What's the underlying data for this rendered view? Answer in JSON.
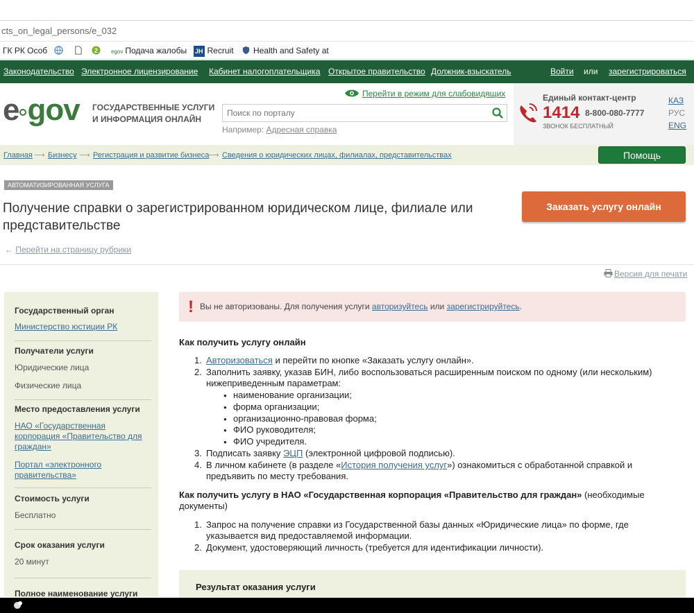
{
  "browser": {
    "url": "cts_on_legal_persons/e_032",
    "bookmarks": [
      "ГК РК Особ",
      "Подача жалобы",
      "Recruit",
      "Health and Safety at"
    ],
    "bookmark_small_icon_text": "egov",
    "bookmark_jh_text": "JH"
  },
  "topnav": {
    "items": [
      "Законодательство",
      "Электронное лицензирование",
      "Кабинет налогоплательщика",
      "Открытое правительство",
      "Должник-взыскатель"
    ],
    "login": "Войти",
    "or": "или",
    "register": "зарегистрироваться"
  },
  "header": {
    "logo": "e gov",
    "tagline": "ГОСУДАРСТВЕННЫЕ УСЛУГИ И ИНФОРМАЦИЯ ОНЛАЙН",
    "low_vision": "Перейти в режим для слабовидящих",
    "search_placeholder": "Поиск по порталу",
    "example_label": "Например:",
    "example_link": "Адресная справка",
    "contact_label": "Единый контакт-центр",
    "contact_short": "1414",
    "contact_phone": "8-800-080-7777",
    "contact_free": "звонок бесплатный",
    "languages": [
      "КАЗ",
      "РУС",
      "ENG"
    ]
  },
  "breadcrumb": {
    "items": [
      "Главная",
      "Бизнесу",
      "Регистрация и развитие бизнеса",
      "Сведения о юридических лицах, филиалах, представительствах"
    ],
    "help": "Помощь"
  },
  "service": {
    "badge": "АВТОМАТИЗИРОВАННАЯ УСЛУГА",
    "title": "Получение справки о зарегистрированном юридическом лице, филиале или представительстве",
    "order_button": "Заказать услугу онлайн",
    "back_link": "Перейти на страницу рубрики",
    "print_link": "Версия для печати"
  },
  "sidebar": {
    "gov_body_h": "Государственный орган",
    "gov_body": "Министерство юстиции РК",
    "recipients_h": "Получатели услуги",
    "recipients": [
      "Юридические лица",
      "Физические лица"
    ],
    "place_h": "Место предоставления услуги",
    "place_1": "НАО «Государственная корпорация «Правительство для граждан»",
    "place_2": "Портал «электронного правительства»",
    "cost_h": "Стоимость услуги",
    "cost": "Бесплатно",
    "term_h": "Срок оказания услуги",
    "term": "20 минут",
    "fullname_h": "Полное наименование услуги"
  },
  "alert": {
    "text_1": "Вы не авторизованы. Для получения услуги",
    "link_1": "авторизуйтесь",
    "text_2": "или",
    "link_2": "зарегистрируйтесь",
    "text_3": "."
  },
  "online": {
    "title": "Как получить услугу онлайн",
    "step1_link": "Авторизоваться",
    "step1_text": "и перейти по кнопке «Заказать услугу онлайн».",
    "step2_line1": "Заполнить заявку, указав БИН, либо воспользоваться расширенным поиском по одному (или нескольким)",
    "step2_line2": "нижеприведенным параметрам:",
    "params": [
      "наименование организации;",
      "форма организации;",
      "организационно-правовая форма;",
      "ФИО руководителя;",
      "ФИО учредителя."
    ],
    "step3_text1": "Подписать заявку",
    "step3_link": "ЭЦП",
    "step3_text2": "(электронной цифровой подписью).",
    "step4_text1": "В личном кабинете (в разделе «",
    "step4_link": "История получения услуг",
    "step4_text2": "») ознакомиться с обработанной справкой и",
    "step4_line2": "предъявить по месту требования."
  },
  "nao": {
    "title_bold": "Как получить услугу в НАО «Государственная корпорация «Правительство для граждан»",
    "title_rest": "(необходимые",
    "title_line2": "документы)",
    "doc1_line1": "Запрос на получение справки из Государственной базы данных «Юридические лица» по форме, где",
    "doc1_line2": "указывается вид предоставляемой информации.",
    "doc2": "Документ, удостоверяющий личность (требуется для идентификации личности)."
  },
  "result": {
    "title": "Результат оказания услуги"
  },
  "colors": {
    "nav_green": "#1f5e36",
    "order_orange": "#dd6a3b",
    "help_green": "#1d7a3a",
    "alert_bg": "#f8e6e4",
    "link_blue": "#3b6b8f"
  }
}
